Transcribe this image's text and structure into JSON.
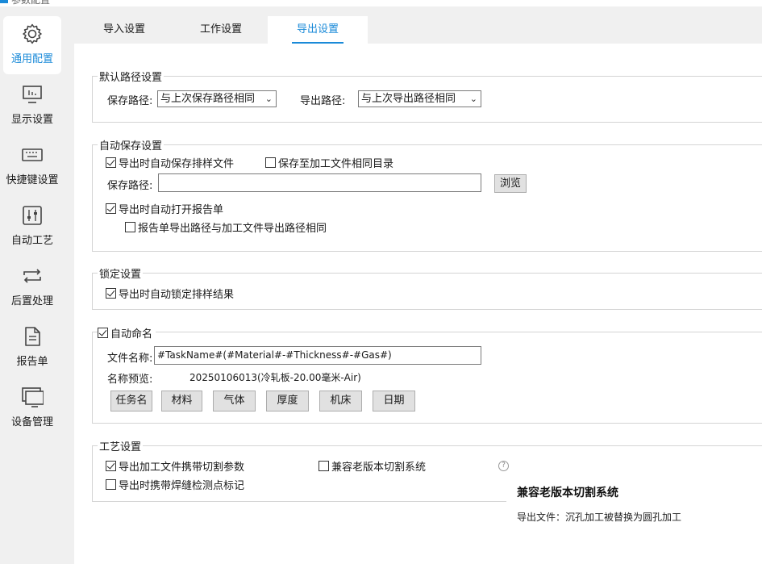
{
  "window": {
    "title": "参数配置"
  },
  "sidebar": {
    "items": [
      {
        "label": "通用配置",
        "icon": "gear-icon",
        "active": true
      },
      {
        "label": "显示设置",
        "icon": "monitor-icon"
      },
      {
        "label": "快捷键设置",
        "icon": "keyboard-icon"
      },
      {
        "label": "自动工艺",
        "icon": "sliders-icon"
      },
      {
        "label": "后置处理",
        "icon": "loop-arrows-icon"
      },
      {
        "label": "报告单",
        "icon": "document-icon"
      },
      {
        "label": "设备管理",
        "icon": "devices-icon"
      }
    ]
  },
  "tabs": [
    {
      "label": "导入设置"
    },
    {
      "label": "工作设置"
    },
    {
      "label": "导出设置",
      "active": true
    }
  ],
  "default_path": {
    "title": "默认路径设置",
    "save_path_label": "保存路径:",
    "save_path_value": "与上次保存路径相同",
    "export_path_label": "导出路径:",
    "export_path_value": "与上次导出路径相同"
  },
  "auto_save": {
    "title": "自动保存设置",
    "auto_save_on_export": "导出时自动保存排样文件",
    "save_to_same_dir": "保存至加工文件相同目录",
    "save_path_label": "保存路径:",
    "save_path_value": "",
    "browse_button": "浏览",
    "auto_open_report": "导出时自动打开报告单",
    "report_same_path": "报告单导出路径与加工文件导出路径相同"
  },
  "lock": {
    "title": "锁定设置",
    "auto_lock": "导出时自动锁定排样结果"
  },
  "auto_naming": {
    "title": "自动命名",
    "file_name_label": "文件名称:",
    "file_name_value": "#TaskName#(#Material#-#Thickness#-#Gas#)",
    "preview_label": "名称预览:",
    "preview_value": "20250106013(冷轧板-20.00毫米-Air)",
    "tags": [
      "任务名",
      "材料",
      "气体",
      "厚度",
      "机床",
      "日期"
    ]
  },
  "process": {
    "title": "工艺设置",
    "carry_cut_params": "导出加工文件携带切割参数",
    "compat_old": "兼容老版本切割系统",
    "weld_marks": "导出时携带焊缝检测点标记",
    "help_glyph": "?"
  },
  "tooltip": {
    "title": "兼容老版本切割系统",
    "description": "导出文件：沉孔加工被替换为圆孔加工"
  },
  "colors": {
    "accent": "#1a8ad8",
    "sidebar_bg": "#f0f0f0"
  }
}
